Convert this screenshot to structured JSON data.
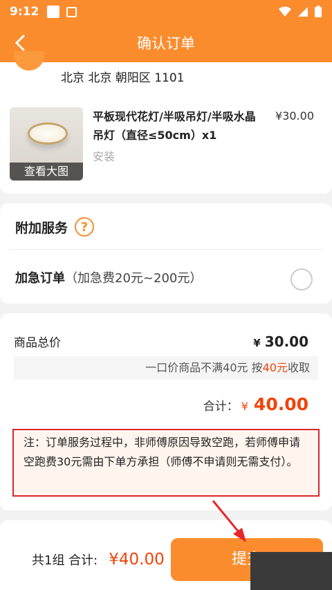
{
  "status_bar": {
    "time": "9:12"
  },
  "nav": {
    "title": "确认订单",
    "back_icon": "chevron-left-icon"
  },
  "address": {
    "text": "北京 北京 朝阳区 1101"
  },
  "product": {
    "title": "平板现代花灯/半吸吊灯/半吸水晶吊灯（直径≤50cm）x1",
    "price": "¥30.00",
    "tag": "安装",
    "thumb_label": "查看大图"
  },
  "services": {
    "title": "附加服务",
    "help_icon": "question-circle-icon",
    "help_glyph": "?",
    "urgent_label": "加急订单",
    "urgent_desc": "（加急费20元~200元）",
    "urgent_selected": false
  },
  "summary": {
    "goods_total_label": "商品总价",
    "goods_total_currency": "¥",
    "goods_total_value": "30.00",
    "fixed_note_prefix": "一口价商品不满40元 按",
    "fixed_note_highlight": "40元",
    "fixed_note_suffix": "收取",
    "total_label": "合计：",
    "total_currency": "¥",
    "total_value": "40.00",
    "warning": "注：订单服务过程中，非师傅原因导致空跑，若师傅申请空跑费30元需由下单方承担（师傅不申请则无需支付）。"
  },
  "bottom_bar": {
    "summary_label": "共1组 合计:",
    "amount": "¥40.00",
    "submit_label": "提交"
  },
  "colors": {
    "accent": "#fb8c2e",
    "price_red": "#f0440a",
    "warning_border": "#d9262c"
  }
}
